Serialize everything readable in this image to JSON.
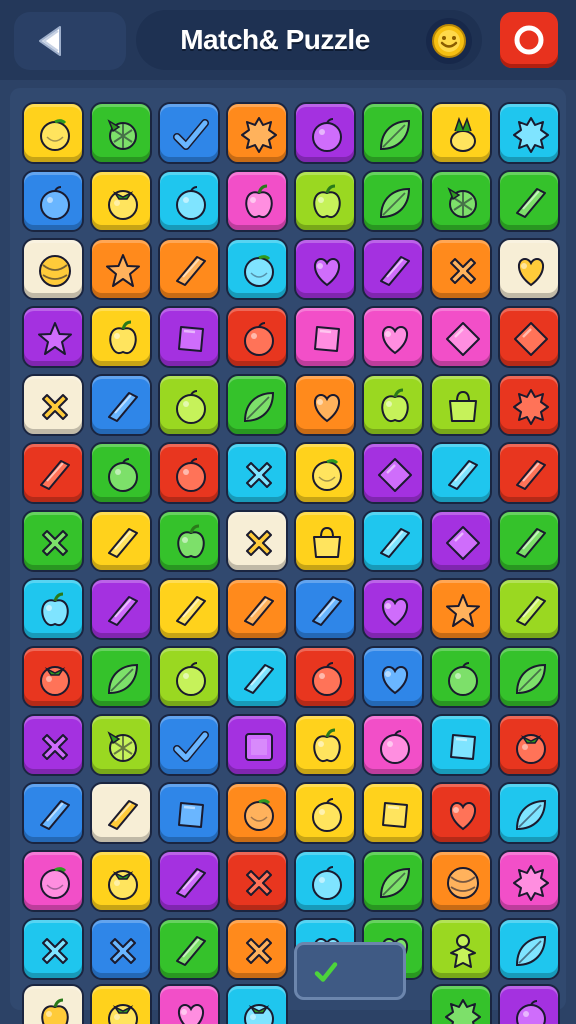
{
  "header": {
    "title": "Match& Puzzle",
    "back_icon": "back-arrow-icon",
    "coin_icon": "coin-icon",
    "close_icon": "close-icon"
  },
  "palette": {
    "y": "#ffd21c",
    "g": "#35c22b",
    "b": "#2f86e8",
    "o": "#ff8a1c",
    "p": "#a431e0",
    "l": "#9ad821",
    "c": "#1fc6ee",
    "k": "#f24fc8",
    "r": "#e8361f",
    "w": "#f7eed6"
  },
  "board": {
    "rows": [
      [
        [
          "y",
          "orange-fruit"
        ],
        [
          "g",
          "berry"
        ],
        [
          "b",
          "check"
        ],
        [
          "o",
          "burst"
        ],
        [
          "p",
          "plum"
        ],
        [
          "g",
          "leaf"
        ],
        [
          "y",
          "pineapple"
        ],
        [
          "c",
          "burst"
        ]
      ],
      [
        [
          "b",
          "plum"
        ],
        [
          "y",
          "tomato"
        ],
        [
          "c",
          "plum"
        ],
        [
          "k",
          "apple"
        ],
        [
          "l",
          "apple"
        ],
        [
          "g",
          "leaf"
        ],
        [
          "g",
          "berry"
        ],
        [
          "g",
          "ribbon"
        ]
      ],
      [
        [
          "w",
          "melon"
        ],
        [
          "o",
          "star"
        ],
        [
          "o",
          "ribbon"
        ],
        [
          "c",
          "orange-fruit"
        ],
        [
          "p",
          "heart"
        ],
        [
          "p",
          "ribbon"
        ],
        [
          "o",
          "cross"
        ],
        [
          "w",
          "heart"
        ]
      ],
      [
        [
          "p",
          "star"
        ],
        [
          "y",
          "apple"
        ],
        [
          "p",
          "gem"
        ],
        [
          "r",
          "plum"
        ],
        [
          "k",
          "gem"
        ],
        [
          "k",
          "heart"
        ],
        [
          "k",
          "diamond"
        ],
        [
          "r",
          "diamond"
        ]
      ],
      [
        [
          "w",
          "cross"
        ],
        [
          "b",
          "ribbon"
        ],
        [
          "l",
          "plum"
        ],
        [
          "g",
          "leaf"
        ],
        [
          "o",
          "heart"
        ],
        [
          "l",
          "apple"
        ],
        [
          "l",
          "bag"
        ],
        [
          "r",
          "burst"
        ]
      ],
      [
        [
          "r",
          "ribbon"
        ],
        [
          "g",
          "plum"
        ],
        [
          "r",
          "plum"
        ],
        [
          "c",
          "cross"
        ],
        [
          "y",
          "orange-fruit"
        ],
        [
          "p",
          "diamond"
        ],
        [
          "c",
          "ribbon"
        ],
        [
          "r",
          "ribbon"
        ]
      ],
      [
        [
          "g",
          "cross"
        ],
        [
          "y",
          "ribbon"
        ],
        [
          "g",
          "apple"
        ],
        [
          "w",
          "cross"
        ],
        [
          "y",
          "bag"
        ],
        [
          "c",
          "ribbon"
        ],
        [
          "p",
          "diamond"
        ],
        [
          "g",
          "ribbon"
        ]
      ],
      [
        [
          "c",
          "apple"
        ],
        [
          "p",
          "ribbon"
        ],
        [
          "y",
          "ribbon"
        ],
        [
          "o",
          "ribbon"
        ],
        [
          "b",
          "ribbon"
        ],
        [
          "p",
          "heart"
        ],
        [
          "o",
          "star"
        ],
        [
          "l",
          "ribbon"
        ]
      ],
      [
        [
          "r",
          "tomato"
        ],
        [
          "g",
          "leaf"
        ],
        [
          "l",
          "plum"
        ],
        [
          "c",
          "ribbon"
        ],
        [
          "r",
          "plum"
        ],
        [
          "b",
          "heart"
        ],
        [
          "g",
          "plum"
        ],
        [
          "g",
          "leaf"
        ]
      ],
      [
        [
          "p",
          "cross"
        ],
        [
          "l",
          "berry"
        ],
        [
          "b",
          "check"
        ],
        [
          "p",
          "square"
        ],
        [
          "y",
          "apple"
        ],
        [
          "k",
          "plum"
        ],
        [
          "c",
          "gem"
        ],
        [
          "r",
          "tomato"
        ]
      ],
      [
        [
          "b",
          "ribbon"
        ],
        [
          "w",
          "ribbon"
        ],
        [
          "b",
          "gem"
        ],
        [
          "o",
          "orange-fruit"
        ],
        [
          "y",
          "plum"
        ],
        [
          "y",
          "gem"
        ],
        [
          "r",
          "heart"
        ],
        [
          "c",
          "leaf"
        ]
      ],
      [
        [
          "k",
          "orange-fruit"
        ],
        [
          "y",
          "tomato"
        ],
        [
          "p",
          "ribbon"
        ],
        [
          "r",
          "cross"
        ],
        [
          "c",
          "plum"
        ],
        [
          "g",
          "leaf"
        ],
        [
          "o",
          "melon"
        ],
        [
          "k",
          "burst"
        ]
      ],
      [
        [
          "c",
          "cross"
        ],
        [
          "b",
          "cross"
        ],
        [
          "g",
          "ribbon"
        ],
        [
          "o",
          "cross"
        ],
        [
          "c",
          "heart"
        ],
        [
          "g",
          "heart"
        ],
        [
          "l",
          "person"
        ],
        [
          "c",
          "leaf"
        ]
      ],
      [
        [
          "w",
          "apple"
        ],
        [
          "y",
          "tomato"
        ],
        [
          "k",
          "heart"
        ],
        [
          "c",
          "tomato"
        ],
        null,
        null,
        [
          "g",
          "burst"
        ],
        [
          "p",
          "plum"
        ]
      ]
    ]
  },
  "slot": {
    "icon": "check-icon"
  }
}
